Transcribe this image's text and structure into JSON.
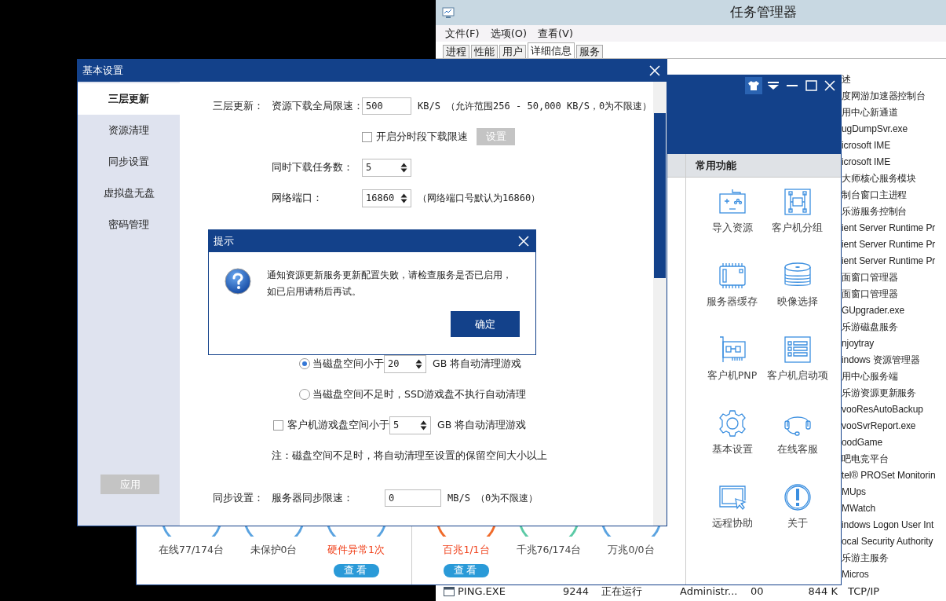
{
  "task_manager": {
    "title": "任务管理器",
    "menu": [
      "文件(F)",
      "选项(O)",
      "查看(V)"
    ],
    "tabs": [
      {
        "label": "进程",
        "selected": false
      },
      {
        "label": "性能",
        "selected": false
      },
      {
        "label": "用户",
        "selected": false
      },
      {
        "label": "详细信息",
        "selected": true
      },
      {
        "label": "服务",
        "selected": false
      }
    ],
    "column_header": "述",
    "descriptions": [
      "度网游加速器控制台",
      "用中心新通道",
      "ugDumpSvr.exe",
      "icrosoft IME",
      "icrosoft IME",
      "大师核心服务模块",
      "制台窗口主进程",
      "乐游服务控制台",
      "ient Server Runtime Pr",
      "ient Server Runtime Pr",
      "ient Server Runtime Pr",
      "面窗口管理器",
      "面窗口管理器",
      "GUpgrader.exe",
      "乐游磁盘服务",
      "njoytray",
      "indows 资源管理器",
      "用中心服务端",
      "乐游资源更新服务",
      "vooResAutoBackup",
      "vooSvrReport.exe",
      "oodGame",
      "吧电竞平台",
      "tel® PROSet Monitorin",
      "MUps",
      "MWatch",
      "indows Logon User Int",
      "ocal Security Authority",
      "乐游主服务",
      "Micros"
    ],
    "bottom_row": {
      "name": "PING.EXE",
      "pid": "9244",
      "status": "正在运行",
      "user": "Administr...",
      "cpu": "00",
      "memory": "844 K",
      "description": "TCP/IP"
    }
  },
  "main_window": {
    "panel_title": "常用功能",
    "functions": [
      {
        "label": "导入资源"
      },
      {
        "label": "客户机分组"
      },
      {
        "label": "服务器缓存"
      },
      {
        "label": "映像选择"
      },
      {
        "label": "客户机PNP"
      },
      {
        "label": "客户机启动项"
      },
      {
        "label": "基本设置"
      },
      {
        "label": "在线客服"
      },
      {
        "label": "远程协助"
      },
      {
        "label": "关于"
      }
    ],
    "stat_groups": [
      {
        "stats": [
          {
            "text": "在线77/174台",
            "alert": false,
            "color": "#5aa3e0"
          },
          {
            "text": "未保护0台",
            "alert": false,
            "color": "#5aa3e0"
          },
          {
            "text": "硬件异常1次",
            "alert": true,
            "color": "#5aa3e0",
            "view_button": "查看"
          }
        ]
      },
      {
        "stats": [
          {
            "text": "百兆1/1台",
            "alert": true,
            "color": "#f06a2a",
            "view_button": "查看"
          },
          {
            "text": "千兆76/174台",
            "alert": false,
            "color": "#5ccaa6"
          },
          {
            "text": "万兆0/0台",
            "alert": false,
            "color": "#5aa3e0"
          }
        ]
      }
    ]
  },
  "settings": {
    "title": "基本设置",
    "sidebar": [
      {
        "label": "三层更新",
        "selected": true
      },
      {
        "label": "资源清理",
        "selected": false
      },
      {
        "label": "同步设置",
        "selected": false
      },
      {
        "label": "虚拟盘无盘",
        "selected": false
      },
      {
        "label": "密码管理",
        "selected": false
      }
    ],
    "apply_button": "应用",
    "three_layer": {
      "section_label": "三层更新：",
      "speed_label": "资源下载全局限速：",
      "speed_value": "500",
      "speed_note": "KB/S （允许范围256 - 50,000 KB/S，0为不限速）",
      "timed_limit": {
        "label": "开启分时段下载限速",
        "checked": false
      },
      "timed_button": "设置",
      "tasks_label": "同时下载任务数：",
      "tasks_value": "5",
      "port_label": "网络端口：",
      "port_value": "16860",
      "port_note": "（网络端口号默认为16860）"
    },
    "cleanup": {
      "options": [
        {
          "kind": "radio-spin",
          "selected": true,
          "label": "当磁盘空间小于",
          "value": "20",
          "unit": "GB 将自动清理游戏"
        },
        {
          "kind": "radio",
          "selected": false,
          "label": "当磁盘空间不足时，SSD游戏盘不执行自动清理"
        }
      ],
      "client": {
        "checked": false,
        "label": "客户机游戏盘空间小于",
        "value": "5",
        "unit": "GB 将自动清理游戏"
      },
      "note": "注：磁盘空间不足时，将自动清理至设置的保留空间大小以上"
    },
    "sync": {
      "section_label": "同步设置：",
      "speed_label": "服务器同步限速：",
      "speed_value": "0",
      "speed_note": "MB/S （0为不限速）"
    }
  },
  "alert": {
    "title": "提示",
    "message": "通知资源更新服务更新配置失败，请检查服务是否已启用，如已启用请稍后再试。",
    "ok_button": "确定"
  }
}
